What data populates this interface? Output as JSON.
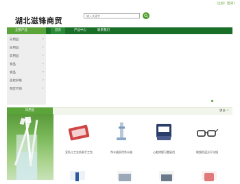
{
  "header": {
    "links": [
      "[注册]",
      "[登录]"
    ],
    "logo": "湖北滋锋商贸",
    "search_placeholder": "输入关键字"
  },
  "nav": {
    "category_label": "全部产品",
    "items": [
      "首页",
      "产品中心",
      "联系我们"
    ]
  },
  "sidebar": {
    "items": [
      "日用品",
      "日用品",
      "日用品",
      "食品",
      "食品",
      "美妆护肤",
      "预定代购"
    ]
  },
  "section": {
    "title": "日用品",
    "more": "更多"
  },
  "products": [
    {
      "name": "宣纸儿工艺纸制手工包"
    },
    {
      "name": "净水器家用净水器"
    },
    {
      "name": "心脏除颤可重复用"
    },
    {
      "name": "眼镜防蓝光平光镜"
    }
  ],
  "colors": {
    "brand_green": "#1a6f28",
    "accent_green": "#5aa43a"
  }
}
